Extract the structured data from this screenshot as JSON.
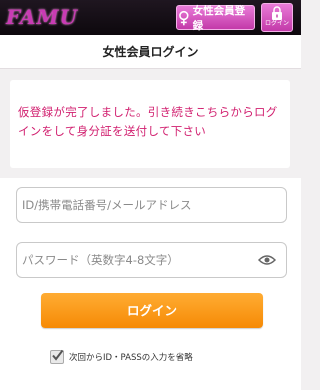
{
  "header": {
    "logo": "FAMU",
    "register_label": "女性会員登録",
    "login_label": "ログイン"
  },
  "page_title": "女性会員ログイン",
  "notice": "仮登録が完了しました。引き続きこちらからログインをして身分証を送付して下さい",
  "form": {
    "id_placeholder": "ID/携帯電話番号/メールアドレス",
    "password_placeholder": "パスワード（英数字4-8文字）",
    "submit_label": "ログイン",
    "remember_label": "次回からID・PASSの入力を省略",
    "remember_checked": true
  },
  "colors": {
    "accent": "#c33aa9",
    "notice_text": "#d11f6f",
    "button": "#f68a05"
  }
}
